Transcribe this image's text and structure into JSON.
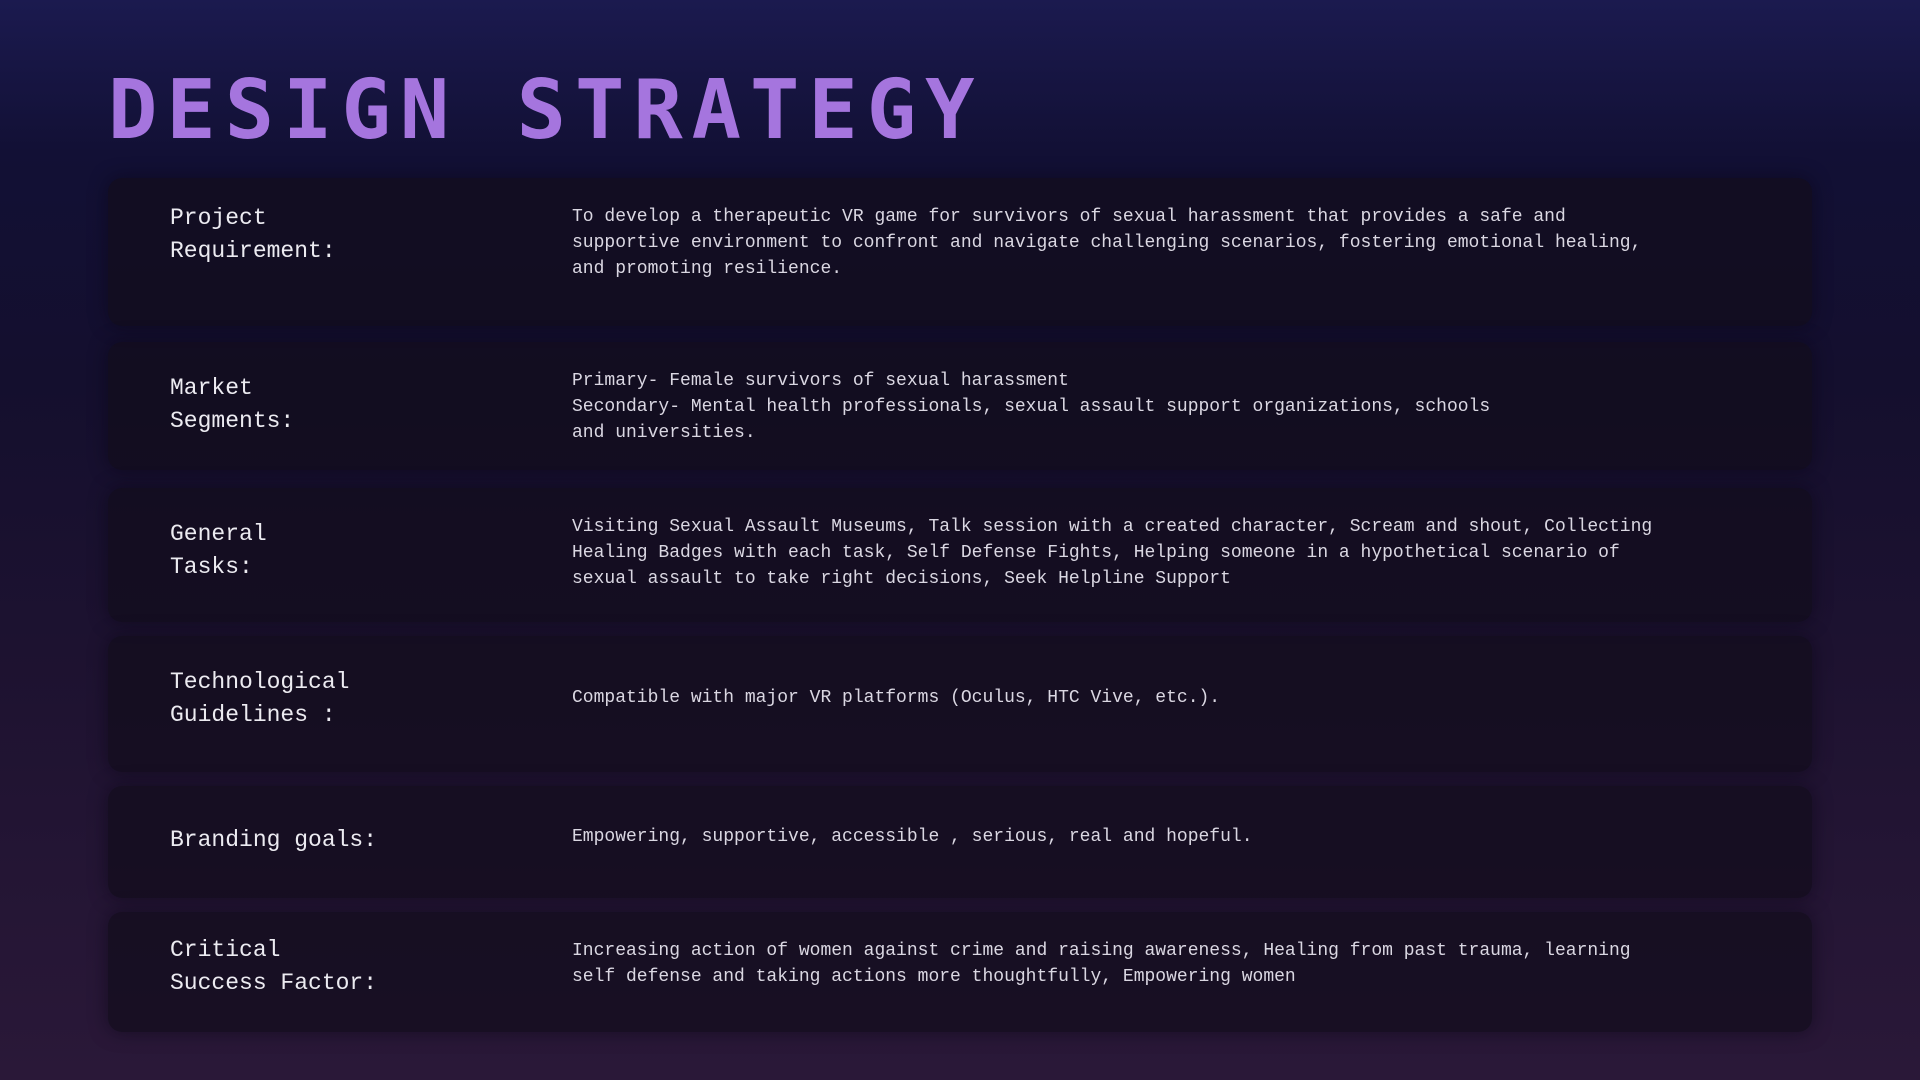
{
  "slide": {
    "title": "DESIGN STRATEGY",
    "rows": [
      {
        "label": "Project\nRequirement:",
        "text": "To develop a therapeutic VR game for survivors of sexual harassment that provides a safe and\nsupportive environment to confront and navigate challenging scenarios, fostering emotional healing,\nand promoting resilience."
      },
      {
        "label": "Market\nSegments:",
        "text": "Primary-  Female survivors of sexual harassment\nSecondary- Mental health professionals, sexual assault support organizations, schools\nand universities."
      },
      {
        "label": "General\nTasks:",
        "text": "Visiting Sexual Assault Museums, Talk session with a created character, Scream and shout, Collecting\nHealing Badges with each task,  Self Defense Fights, Helping someone in a hypothetical scenario of\nsexual assault to take right decisions, Seek Helpline Support"
      },
      {
        "label": "Technological\nGuidelines :",
        "text": "Compatible with major VR platforms (Oculus, HTC Vive, etc.)."
      },
      {
        "label": "Branding goals:",
        "text": "Empowering, supportive,  accessible , serious, real and hopeful."
      },
      {
        "label": "Critical\nSuccess Factor:",
        "text": "Increasing action of women against crime and raising awareness, Healing from past trauma, learning\nself defense and taking  actions more thoughtfully, Empowering women"
      }
    ]
  },
  "colors": {
    "title": "#a575de",
    "panel": "#140d1e",
    "text": "#e6e3ec"
  }
}
